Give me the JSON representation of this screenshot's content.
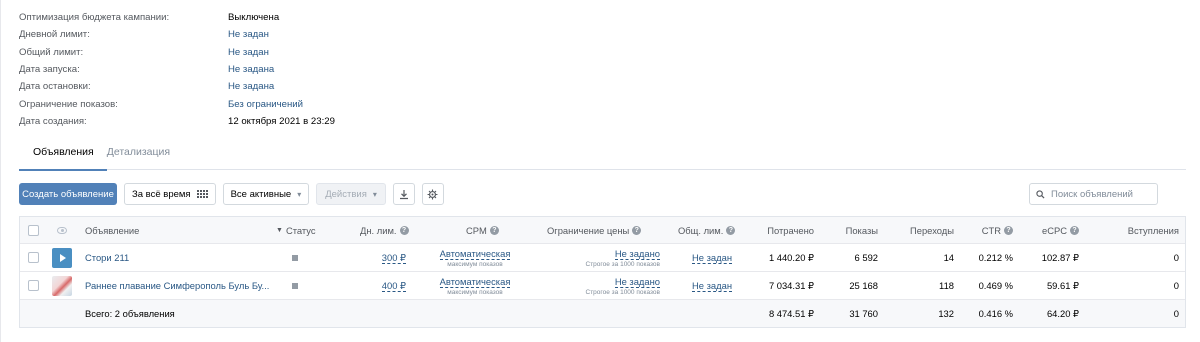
{
  "info": [
    {
      "label": "Оптимизация бюджета кампании:",
      "value": "Выключена",
      "link": false
    },
    {
      "label": "Дневной лимит:",
      "value": "Не задан",
      "link": true
    },
    {
      "label": "Общий лимит:",
      "value": "Не задан",
      "link": true
    },
    {
      "label": "Дата запуска:",
      "value": "Не задана",
      "link": true
    },
    {
      "label": "Дата остановки:",
      "value": "Не задана",
      "link": true
    },
    {
      "label": "Ограничение показов:",
      "value": "Без ограничений",
      "link": true
    },
    {
      "label": "Дата создания:",
      "value": "12 октября 2021 в 23:29",
      "link": false
    }
  ],
  "tabs": [
    "Объявления",
    "Детализация"
  ],
  "toolbar": {
    "create": "Создать объявление",
    "period": "За всё время",
    "filter": "Все активные",
    "actions": "Действия"
  },
  "search": {
    "placeholder": "Поиск объявлений"
  },
  "columns": {
    "ad": "Объявление",
    "status": "Статус",
    "day_limit": "Дн. лим.",
    "cpm": "CPM",
    "price_limit": "Ограничение цены",
    "total_limit": "Общ. лим.",
    "spent": "Потрачено",
    "impressions": "Показы",
    "clicks": "Переходы",
    "ctr": "CTR",
    "ecpc": "eCPC",
    "joins": "Вступления"
  },
  "rows": [
    {
      "name": "Стори 211",
      "thumb": "video",
      "day_limit": "300 ₽",
      "cpm": "Автоматическая",
      "cpm_sub": "максимум показов",
      "price_limit": "Не задано",
      "price_limit_sub": "Строгое за 1000 показов",
      "total_limit": "Не задан",
      "spent": "1 440.20 ₽",
      "impressions": "6 592",
      "clicks": "14",
      "ctr": "0.212 %",
      "ecpc": "102.87 ₽",
      "joins": "0"
    },
    {
      "name": "Раннее плавание Симферополь Буль Бу...",
      "thumb": "photo",
      "day_limit": "400 ₽",
      "cpm": "Автоматическая",
      "cpm_sub": "максимум показов",
      "price_limit": "Не задано",
      "price_limit_sub": "Строгое за 1000 показов",
      "total_limit": "Не задан",
      "spent": "7 034.31 ₽",
      "impressions": "25 168",
      "clicks": "118",
      "ctr": "0.469 %",
      "ecpc": "59.61 ₽",
      "joins": "0"
    }
  ],
  "total": {
    "label": "Всего: 2 объявления",
    "spent": "8 474.51 ₽",
    "impressions": "31 760",
    "clicks": "132",
    "ctr": "0.416 %",
    "ecpc": "64.20 ₽",
    "joins": "0"
  }
}
